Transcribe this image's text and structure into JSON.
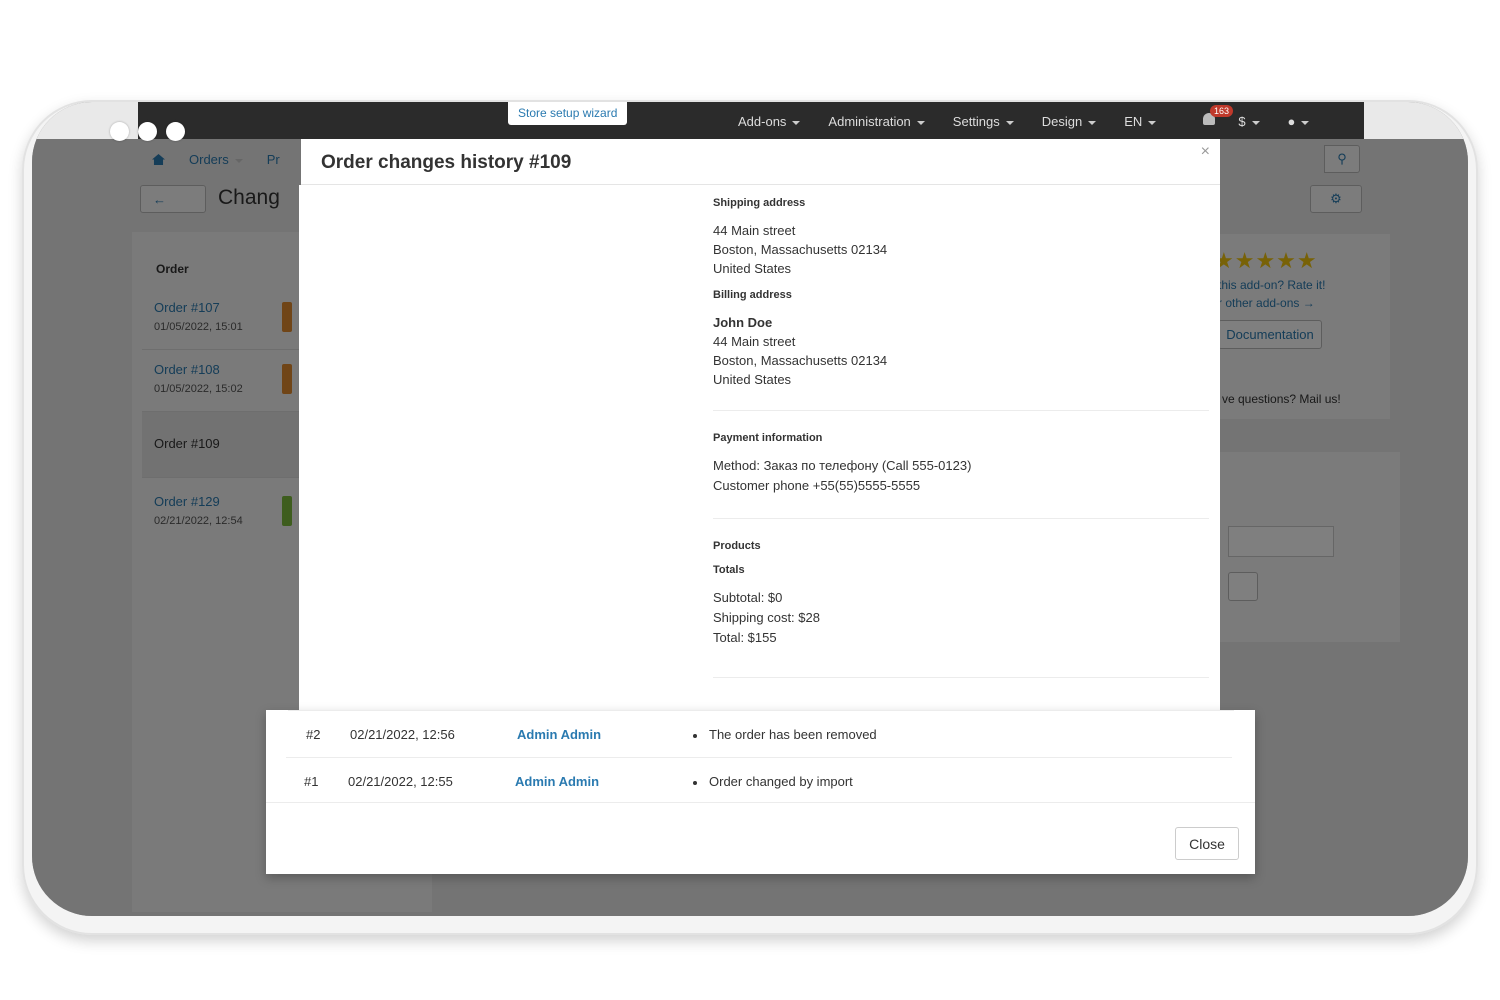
{
  "topbar": {
    "wizard_label": "Store setup wizard",
    "menu": [
      "Add-ons",
      "Administration",
      "Settings",
      "Design",
      "EN",
      "$"
    ],
    "notification_count": "163"
  },
  "background": {
    "breadcrumb": [
      "Orders",
      "Pr"
    ],
    "page_title": "Chang",
    "orders_header": "Order",
    "orders": [
      {
        "label": "Order #107",
        "date": "01/05/2022, 15:01",
        "tag_color": "#e08a2e"
      },
      {
        "label": "Order #108",
        "date": "01/05/2022, 15:02",
        "tag_color": "#e08a2e"
      },
      {
        "label": "Order #109",
        "date": "",
        "tag_color": ""
      },
      {
        "label": "Order #129",
        "date": "02/21/2022, 12:54",
        "tag_color": "#7cbb3c"
      }
    ],
    "right_panel": {
      "stars": "★★★★★",
      "rate_text": "this add-on? Rate it!",
      "other_addons": "r other add-ons →",
      "doc_button": "Documentation",
      "questions": "ve questions? Mail us!"
    }
  },
  "modal": {
    "title": "Order changes history #109",
    "close_x": "×",
    "shipping": {
      "title": "Shipping address",
      "lines": [
        "44 Main street",
        "Boston, Massachusetts 02134",
        "United States"
      ]
    },
    "billing": {
      "title": "Billing address",
      "name": "John Doe",
      "lines": [
        "44 Main street",
        "Boston, Massachusetts 02134",
        "United States"
      ]
    },
    "payment": {
      "title": "Payment information",
      "lines": [
        "Method: Заказ по телефону (Call 555-0123)",
        "Customer phone +55(55)5555-5555"
      ]
    },
    "products_title": "Products",
    "totals": {
      "title": "Totals",
      "lines": [
        "Subtotal: $0",
        "Shipping cost: $28",
        "Total: $155"
      ]
    },
    "history": [
      {
        "num": "#2",
        "time": "02/21/2022, 12:56",
        "user": "Admin Admin",
        "change": "The order has been removed"
      },
      {
        "num": "#1",
        "time": "02/21/2022, 12:55",
        "user": "Admin Admin",
        "change": "Order changed by import"
      }
    ],
    "close_button": "Close"
  }
}
